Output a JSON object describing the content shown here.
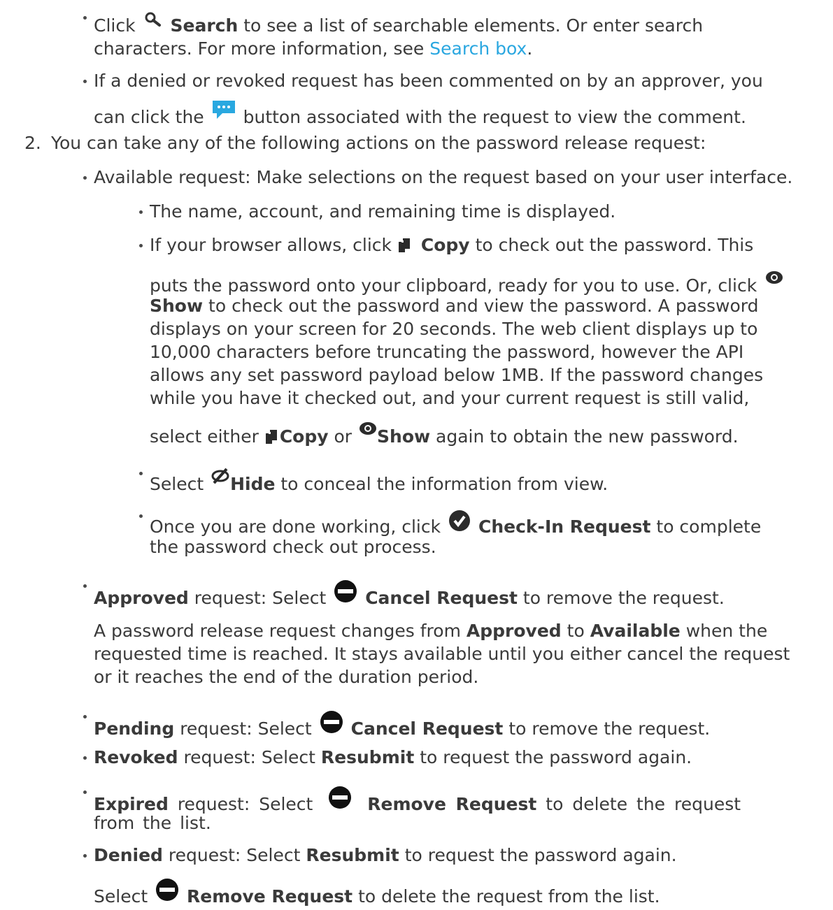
{
  "intro": {
    "search_click": "Click",
    "search_label": "Search",
    "search_rest_1": "to see a list of searchable elements. Or enter search",
    "search_rest_2": "characters. For more information, see",
    "search_link": "Search box",
    "search_period": ".",
    "comment_1": "If a denied or revoked request has been commented on by an approver, you",
    "comment_2a": "can click the",
    "comment_2b": "button associated with the request to view the comment."
  },
  "step2": {
    "number": "2.",
    "text": "You can take any of the following actions on the password release request:"
  },
  "available": {
    "text": "Available request: Make selections on the request based on your user interface.",
    "item1": "The name, account, and remaining time is displayed.",
    "item2_a": "If your browser allows, click",
    "copy_label": "Copy",
    "item2_b": "to check out the password. This",
    "item2_c": "puts the password onto your clipboard, ready for you to use. Or, click",
    "show_label": "Show",
    "item2_d": "to check out the password and view the password. A password",
    "item2_e": "displays on your screen for 20 seconds. The web client displays up to",
    "item2_f": "10,000 characters before truncating the password, however the API",
    "item2_g": "allows any set password payload below 1MB. If the password changes",
    "item2_h": "while you have it checked out, and your current request is still valid,",
    "item2_i": "select either",
    "item2_or": "or",
    "item2_j": "again to obtain the new password.",
    "hide_select": "Select",
    "hide_label": "Hide",
    "hide_rest": "to conceal the information from view.",
    "checkin_a": "Once you are done working, click",
    "checkin_label": "Check-In Request",
    "checkin_b": "to complete",
    "checkin_c": "the password check out process."
  },
  "approved": {
    "status": "Approved",
    "a": "request: Select",
    "action": "Cancel Request",
    "b": "to remove the request.",
    "p1_a": "A password release request changes from",
    "p1_from": "Approved",
    "p1_to_word": "to",
    "p1_to": "Available",
    "p1_b": "when the",
    "p2": "requested time is reached. It stays available until you either cancel the request",
    "p3": "or it reaches the end of the duration period."
  },
  "pending": {
    "status": "Pending",
    "a": "request: Select",
    "action": "Cancel Request",
    "b": "to remove the request."
  },
  "revoked": {
    "status": "Revoked",
    "a": "request: Select",
    "action": "Resubmit",
    "b": "to request the password again."
  },
  "expired": {
    "status": "Expired",
    "a": "request: Select",
    "action": "Remove Request",
    "b": "to delete the request",
    "c": "from the list."
  },
  "denied": {
    "status": "Denied",
    "a": "request: Select",
    "action": "Resubmit",
    "b": "to request the password again.",
    "remove_select": "Select",
    "remove_action": "Remove Request",
    "remove_b": "to delete the request from the list."
  },
  "colors": {
    "text": "#3a3a3a",
    "link": "#2aa7e0",
    "comment_icon": "#29a8e0"
  }
}
